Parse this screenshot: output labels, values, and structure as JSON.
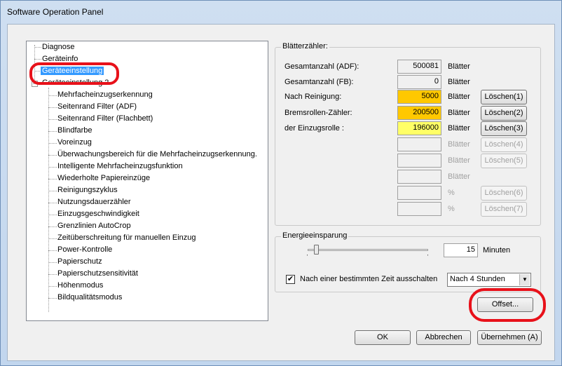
{
  "window": {
    "title": "Software Operation Panel"
  },
  "tree": {
    "items": [
      "Diagnose",
      "Geräteinfo",
      "Geräteeinstellung",
      "Geräteeinstellung 2",
      "Mehrfacheinzugserkennung",
      "Seitenrand Filter (ADF)",
      "Seitenrand Filter (Flachbett)",
      "Blindfarbe",
      "Voreinzug",
      "Überwachungsbereich für die Mehrfacheinzugserkennung.",
      "Intelligente Mehrfacheinzugsfunktion",
      "Wiederholte Papiereinzüge",
      "Reinigungszyklus",
      "Nutzungsdauerzähler",
      "Einzugsgeschwindigkeit",
      "Grenzlinien AutoCrop",
      "Zeitüberschreitung für manuellen Einzug",
      "Power-Kontrolle",
      "Papierschutz",
      "Papierschutzsensitivität",
      "Höhenmodus",
      "Bildqualitätsmodus"
    ],
    "selected": "Geräteeinstellung",
    "collapse_symbol": "−"
  },
  "counter": {
    "legend": "Blätterzähler:",
    "unit": "Blätter",
    "rows": [
      {
        "label": "Gesamtanzahl (ADF):",
        "value": "500081",
        "unit": "Blätter"
      },
      {
        "label": "Gesamtanzahl (FB):",
        "value": "0",
        "unit": "Blätter"
      },
      {
        "label": "Nach Reinigung:",
        "value": "5000",
        "unit": "Blätter",
        "button": "Löschen(1)",
        "color": "#ffc800"
      },
      {
        "label": "Bremsrollen-Zähler:",
        "value": "200500",
        "unit": "Blätter",
        "button": "Löschen(2)",
        "color": "#ffc800"
      },
      {
        "label": "der Einzugsrolle :",
        "value": "196000",
        "unit": "Blätter",
        "button": "Löschen(3)",
        "color": "#ffff66"
      },
      {
        "label": "",
        "value": "",
        "unit": "Blätter",
        "button": "Löschen(4)"
      },
      {
        "label": "",
        "value": "",
        "unit": "Blätter",
        "button": "Löschen(5)"
      },
      {
        "label": "",
        "value": "",
        "unit": "Blätter"
      },
      {
        "label": "",
        "value": "",
        "unit": "%",
        "button": "Löschen(6)"
      },
      {
        "label": "",
        "value": "",
        "unit": "%",
        "button": "Löschen(7)"
      }
    ]
  },
  "energy": {
    "legend": "Energieeinsparung",
    "minutes_value": "15",
    "minutes_label": "Minuten",
    "checkbox_label": "Nach einer bestimmten Zeit ausschalten",
    "checkbox_mark": "✔",
    "select_value": "Nach 4 Stunden",
    "arrow": "▼"
  },
  "buttons": {
    "offset": "Offset...",
    "ok": "OK",
    "cancel": "Abbrechen",
    "apply": "Übernehmen (A)"
  },
  "colors": {
    "selection": "#3399ff",
    "highlight": "#e8111a",
    "orange_field": "#ffc800",
    "yellow_field": "#ffff66"
  }
}
